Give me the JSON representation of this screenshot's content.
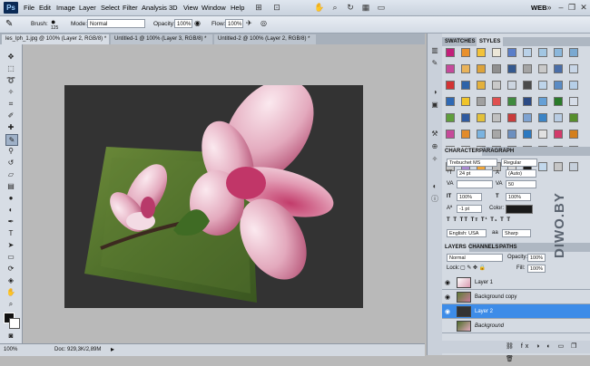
{
  "menu": {
    "items": [
      "File",
      "Edit",
      "Image",
      "Layer",
      "Select",
      "Filter",
      "Analysis",
      "3D",
      "View",
      "Window",
      "Help"
    ],
    "workspace": "WEB"
  },
  "options": {
    "brush_label": "Brush:",
    "brush_size": "125",
    "mode_label": "Mode:",
    "mode_value": "Normal",
    "opacity_label": "Opacity:",
    "opacity_value": "100%",
    "flow_label": "Flow:",
    "flow_value": "100%"
  },
  "tabs": [
    "les_lph_1.jpg @ 100% (Layer 2, RGB/8) *",
    "Untitled-1 @ 100% (Layer 3, RGB/8) *",
    "Untitled-2 @ 100% (Layer 2, RGB/8) *"
  ],
  "status": {
    "zoom": "100%",
    "doc": "Doc: 929,3K/2,89M"
  },
  "swatches_panel": {
    "tabs": [
      "SWATCHES",
      "STYLES"
    ]
  },
  "character": {
    "tabs": [
      "CHARACTER",
      "PARAGRAPH"
    ],
    "font": "Trebuchet MS",
    "style": "Regular",
    "size": "24 pt",
    "leading": "(Auto)",
    "tracking": "50",
    "vscale": "100%",
    "hscale": "100%",
    "baseline": "-1 pt",
    "color_label": "Color:",
    "language": "English: USA",
    "aa_label": "aa",
    "antialias": "Sharp"
  },
  "layers": {
    "tabs": [
      "LAYERS",
      "CHANNELS",
      "PATHS"
    ],
    "blend": "Normal",
    "opacity_label": "Opacity:",
    "opacity": "100%",
    "lock_label": "Lock:",
    "fill_label": "Fill:",
    "fill": "100%",
    "items": [
      "Layer 1",
      "Background copy",
      "Layer 2",
      "Background"
    ]
  },
  "watermark": "DIWO.BY",
  "colors": {
    "accent": "#3d8ce8",
    "style_cells": [
      "#c21f7a",
      "#e8902c",
      "#f2c23a",
      "#ece7d8",
      "#5a7ec9",
      "#b9d1e8",
      "#a2c6e2",
      "#8bb7db",
      "#7aa9d1",
      "#c54a9c",
      "#e9b35a",
      "#dca33b",
      "#8f8f8f",
      "#34598f",
      "#a4a4a4",
      "#c9c9c9",
      "#4a6ea8",
      "#c8d6e7",
      "#d33333",
      "#2e63a8",
      "#e4b13d",
      "#c9c9c9",
      "#ccd5e0",
      "#4b4b4b",
      "#bdd4ea",
      "#5a8bc4",
      "#b6cfe8",
      "#2f69b4",
      "#f0c42a",
      "#a0a0a0",
      "#e05050",
      "#3f8a3f",
      "#2c4b85",
      "#66a0d6",
      "#2a7a2a",
      "#d6dde8",
      "#5f9e3c",
      "#2f5aa0",
      "#e3c13a",
      "#c0c0c0",
      "#c93c3c",
      "#7ea3d2",
      "#3b84c6",
      "#b8cce3",
      "#568f2c",
      "#c64a9a",
      "#e38b2a",
      "#7ab3e0",
      "#a7a7a7",
      "#6c8fbf",
      "#2b78c0",
      "#e1e1e1",
      "#d23a6a",
      "#d47f1c",
      "#3a72b9",
      "#d7a63a",
      "#a6c8e6",
      "#9ebde0",
      "#3a8c3a",
      "#3d7bb8",
      "#aac6e6",
      "#d7d7d7",
      "#3a3a3a",
      "#c5c5c5",
      "#ab8ad0",
      "#f0a63a",
      "#b9b9b9",
      "#d6d6d6",
      "#1e1e1e",
      "#c2d8ec",
      "#c6c6c6",
      "#c6d0dc"
    ]
  }
}
